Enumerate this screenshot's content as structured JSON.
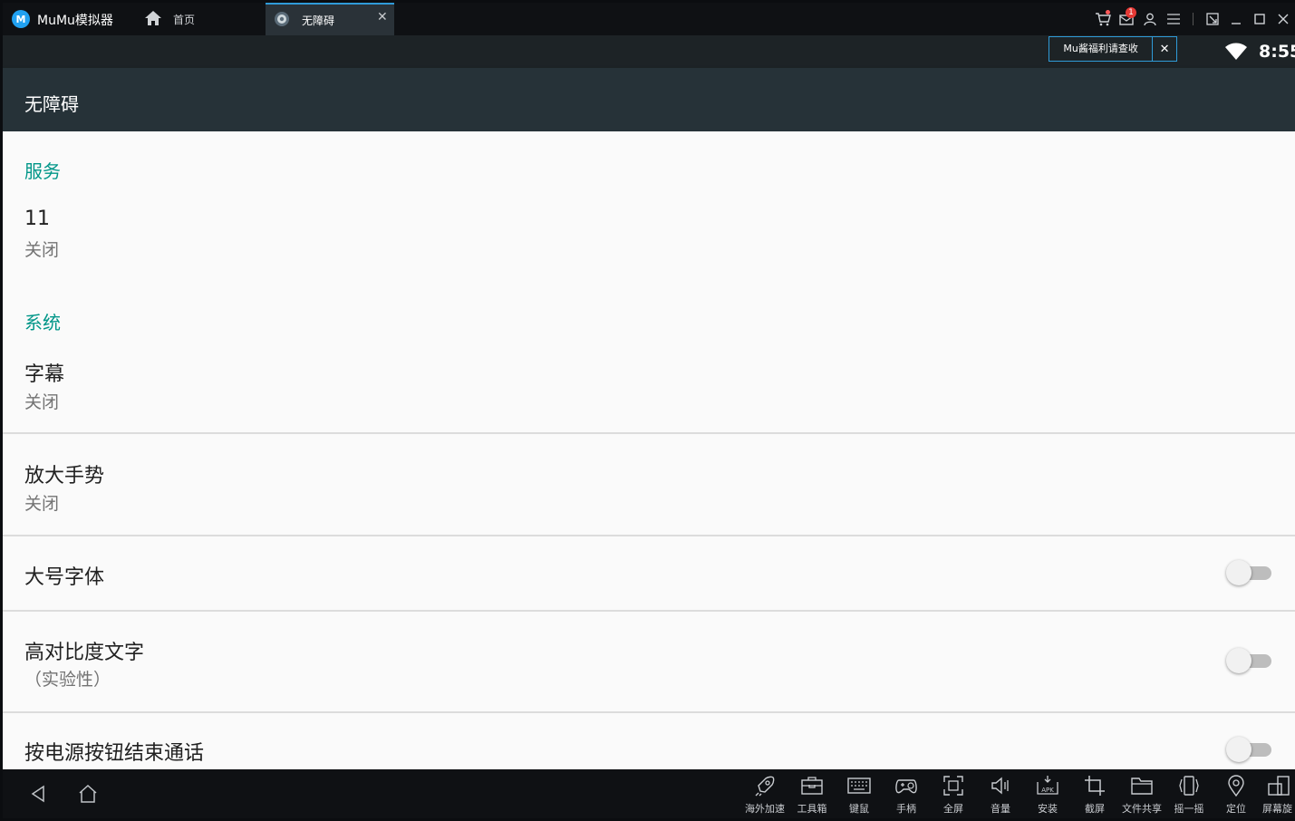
{
  "window": {
    "app_name": "MuMu模拟器",
    "tabs": [
      {
        "label": "首页"
      },
      {
        "label": "无障碍"
      }
    ],
    "notification_badge": "1"
  },
  "status": {
    "notice": "Mu酱福利请查收",
    "time": "8:55"
  },
  "page": {
    "title": "无障碍",
    "sections": [
      {
        "header": "服务"
      },
      {
        "header": "系统"
      }
    ],
    "items": [
      {
        "title": "11",
        "summary": "关闭"
      },
      {
        "title": "字幕",
        "summary": "关闭"
      },
      {
        "title": "放大手势",
        "summary": "关闭"
      },
      {
        "title": "大号字体",
        "switch_on": false
      },
      {
        "title": "高对比度文字",
        "summary": "（实验性）",
        "switch_on": false
      },
      {
        "title": "按电源按钮结束通话",
        "switch_on": false
      }
    ]
  },
  "toolbar": {
    "tools": [
      {
        "label": "海外加速",
        "icon": "rocket-icon"
      },
      {
        "label": "工具箱",
        "icon": "toolbox-icon"
      },
      {
        "label": "键鼠",
        "icon": "keyboard-icon"
      },
      {
        "label": "手柄",
        "icon": "gamepad-icon"
      },
      {
        "label": "全屏",
        "icon": "fullscreen-icon"
      },
      {
        "label": "音量",
        "icon": "volume-icon"
      },
      {
        "label": "安装",
        "icon": "apk-icon"
      },
      {
        "label": "截屏",
        "icon": "crop-icon"
      },
      {
        "label": "文件共享",
        "icon": "folder-icon"
      },
      {
        "label": "摇一摇",
        "icon": "shake-icon"
      },
      {
        "label": "定位",
        "icon": "location-icon"
      },
      {
        "label": "屏幕旋",
        "icon": "rotate-icon"
      }
    ]
  },
  "colors": {
    "accent": "#009688",
    "action_bar": "#263238",
    "tab_highlight": "#2f9bd8"
  }
}
